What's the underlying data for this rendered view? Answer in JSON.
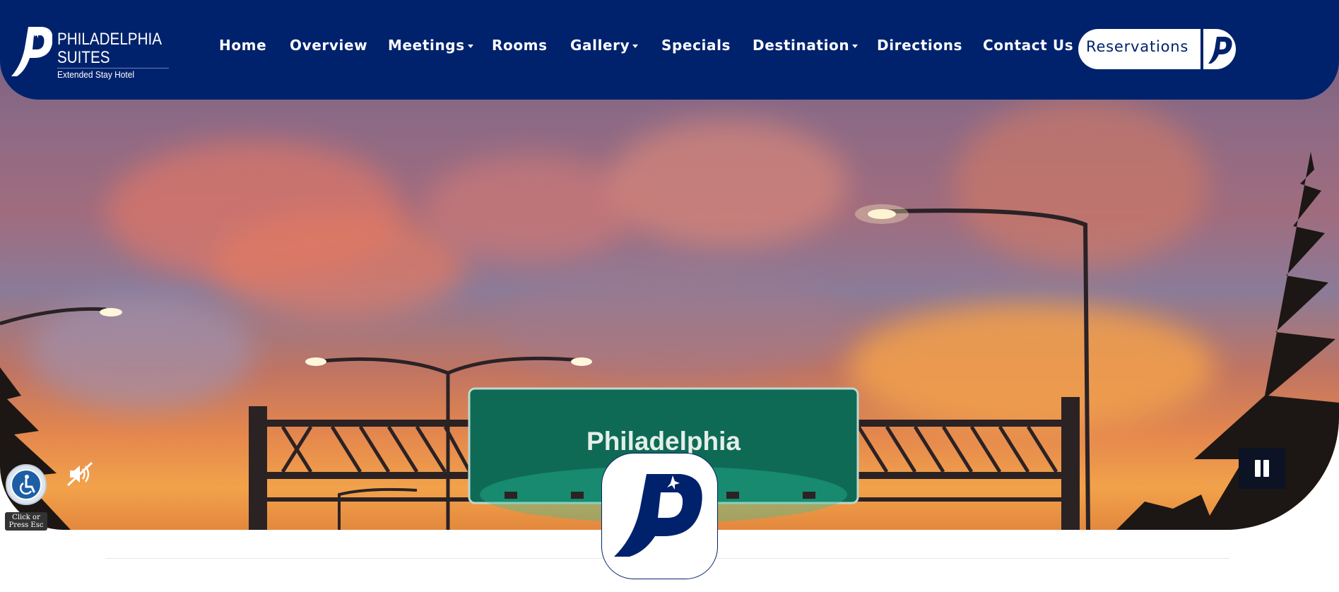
{
  "brand": {
    "name_line1": "PHILADELPHIA",
    "name_line2": "SUITES",
    "tagline": "Extended Stay Hotel",
    "logo_icon": "p-airplane-logo-icon"
  },
  "nav": {
    "items": [
      {
        "label": "Home",
        "dropdown": false
      },
      {
        "label": "Overview",
        "dropdown": false
      },
      {
        "label": "Meetings",
        "dropdown": true
      },
      {
        "label": "Rooms",
        "dropdown": false
      },
      {
        "label": "Gallery",
        "dropdown": true
      },
      {
        "label": "Specials",
        "dropdown": false
      },
      {
        "label": "Destination",
        "dropdown": true
      },
      {
        "label": "Directions",
        "dropdown": false
      },
      {
        "label": "Contact Us",
        "dropdown": false
      }
    ],
    "reservations_label": "Reservations"
  },
  "hero": {
    "sign_text": "Philadelphia",
    "video_muted": true,
    "video_playing": true
  },
  "accessibility": {
    "tooltip_line1": "Click or",
    "tooltip_line2": "Press Esc",
    "icon": "wheelchair-icon"
  },
  "colors": {
    "brand_navy": "#00226d",
    "sign_green": "#0f6a55",
    "white": "#ffffff"
  }
}
